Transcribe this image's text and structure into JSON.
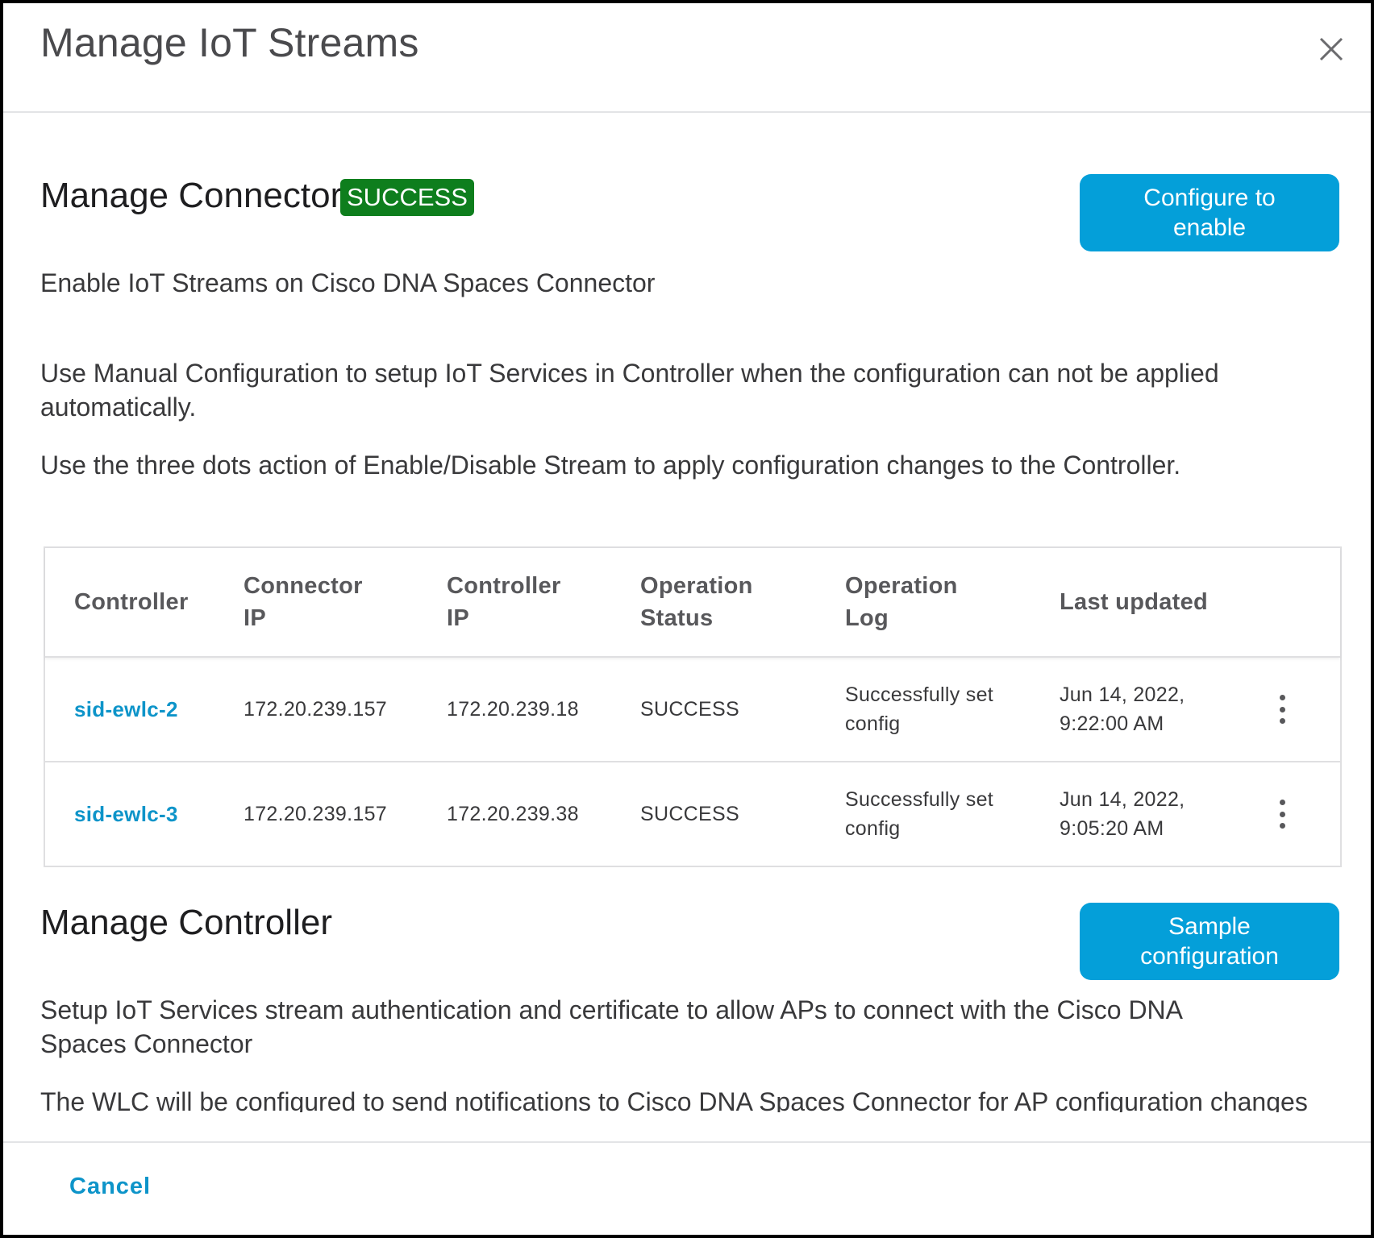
{
  "modal": {
    "title": "Manage IoT Streams",
    "close_icon": "close-icon"
  },
  "connector": {
    "title": "Manage Connector",
    "status_badge": "SUCCESS",
    "badge_color": "#0e7e1d",
    "configure_button": "Configure to enable",
    "description": "Enable IoT Streams on Cisco DNA Spaces Connector",
    "manual_note": "Use Manual Configuration to setup IoT Services in Controller when the configuration can not be applied automatically.",
    "dots_note": "Use the three dots action of Enable/Disable Stream to apply configuration changes to the Controller."
  },
  "table": {
    "columns": [
      "Controller",
      "Connector IP",
      "Controller IP",
      "Operation Status",
      "Operation Log",
      "Last updated"
    ],
    "rows": [
      {
        "controller": "sid-ewlc-2",
        "connector_ip": "172.20.239.157",
        "controller_ip": "172.20.239.18",
        "status": "SUCCESS",
        "log": "Successfully set config",
        "last_updated": "Jun 14, 2022, 9:22:00 AM",
        "action_icon": "more-vertical-icon"
      },
      {
        "controller": "sid-ewlc-3",
        "connector_ip": "172.20.239.157",
        "controller_ip": "172.20.239.38",
        "status": "SUCCESS",
        "log": "Successfully set config",
        "last_updated": "Jun 14, 2022, 9:05:20 AM",
        "action_icon": "more-vertical-icon"
      }
    ]
  },
  "controller_section": {
    "title": "Manage Controller",
    "sample_button": "Sample configuration",
    "setup_note": "Setup IoT Services stream authentication and certificate to allow APs to connect with the Cisco DNA Spaces Connector",
    "wlc_note": "The WLC will be configured to send notifications to Cisco DNA Spaces Connector for AP configuration changes"
  },
  "footer": {
    "cancel_label": "Cancel"
  },
  "colors": {
    "accent": "#049fd9",
    "link": "#0d94c9",
    "success": "#0e7e1d"
  }
}
